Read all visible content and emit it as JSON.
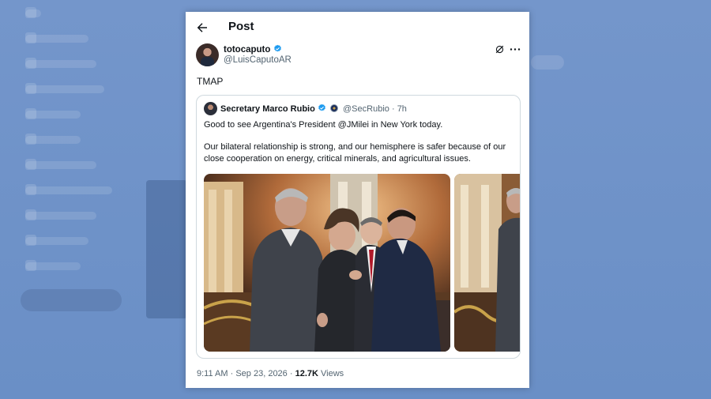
{
  "header": {
    "title": "Post"
  },
  "post": {
    "author_name": "totocaputo",
    "author_handle": "@LuisCaputoAR",
    "text": "TMAP",
    "timestamp": "9:11 AM",
    "date": "Sep 23, 2026",
    "views_count": "12.7K",
    "views_label": "Views"
  },
  "quoted_post": {
    "author_name": "Secretary Marco Rubio",
    "author_handle": "@SecRubio",
    "age": "7h",
    "paragraph_1": "Good to see Argentina's President @JMilei in New York today.",
    "paragraph_2": "Our bilateral relationship is strong, and our hemisphere is safer because of our close cooperation on energy, critical minerals, and agricultural issues."
  },
  "icons": {
    "back": "arrow-left-icon",
    "verified": "verified-badge-icon",
    "grok": "grok-icon",
    "more": "more-options-icon",
    "seal": "government-seal-icon"
  },
  "colors": {
    "verified": "#1d9bf0",
    "text_primary": "#0f1419",
    "text_secondary": "#536471",
    "border": "#cfd9de"
  }
}
